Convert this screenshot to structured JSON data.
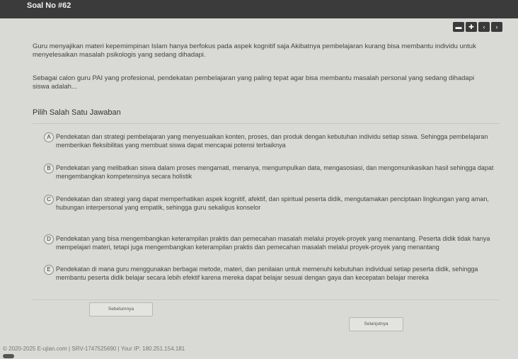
{
  "header": {
    "title": "Soal No #62"
  },
  "nav": {
    "buttons": [
      "▬",
      "✚",
      "‹",
      "›"
    ]
  },
  "question": {
    "paragraph1": "Guru menyajikan materi kepemimpinan Islam hanya berfokus pada aspek kognitif saja Akibatnya pembelajaran kurang bisa membantu individu untuk menyelesaikan masalah psikologis yang sedang dihadapi.",
    "paragraph2": "Sebagai calon guru PAI yang profesional, pendekatan pembelajaran yang paling tepat agar bisa membantu masalah personal yang sedang dihadapi siswa adalah..."
  },
  "instruction": "Pilih Salah Satu Jawaban",
  "options": [
    {
      "letter": "A",
      "text": "Pendekatan dan strategi pembelajaran yang menyesuaikan konten, proses, dan produk dengan kebutuhan individu setiap siswa. Sehingga pembelajaran memberikan fleksibilitas yang membuat siswa dapat mencapai potensi terbaiknya"
    },
    {
      "letter": "B",
      "text": "Pendekatan yang melibatkan siswa dalam proses mengamati, menanya, mengumpulkan data, mengasosiasi, dan mengomunikasikan hasil sehingga dapat mengembangkan kompetensinya secara holistik"
    },
    {
      "letter": "C",
      "text": "Pendekatan dan strategi yang dapat memperhatikan aspek kognitif, afektif, dan spiritual peserta didik, mengutamakan penciptaan lingkungan yang aman, hubungan interpersonal yang empatik, sehingga guru sekaligus konselor"
    },
    {
      "letter": "D",
      "text": "Pendekatan yang bisa mengembangkan keterampilan praktis dan pemecahan masalah melalui proyek-proyek yang menantang. Peserta didik tidak hanya mempelajari materi, tetapi juga mengembangkan keterampilan praktis dan pemecahan masalah melalui proyek-proyek yang menantang"
    },
    {
      "letter": "E",
      "text": "Pendekatan di mana guru menggunakan berbagai metode, materi, dan penilaian untuk memenuhi kebutuhan individual setiap peserta didik, sehingga membantu peserta didik belajar secara lebih efektif karena mereka dapat belajar sesuai dengan gaya dan kecepatan belajar mereka"
    }
  ],
  "buttons": {
    "prev": "Sebelumnya",
    "next": "Selanjutnya"
  },
  "footer": "© 2020-2025 E-ujian.com | SRV-1747525690 | Your IP: 180.251.154.181"
}
